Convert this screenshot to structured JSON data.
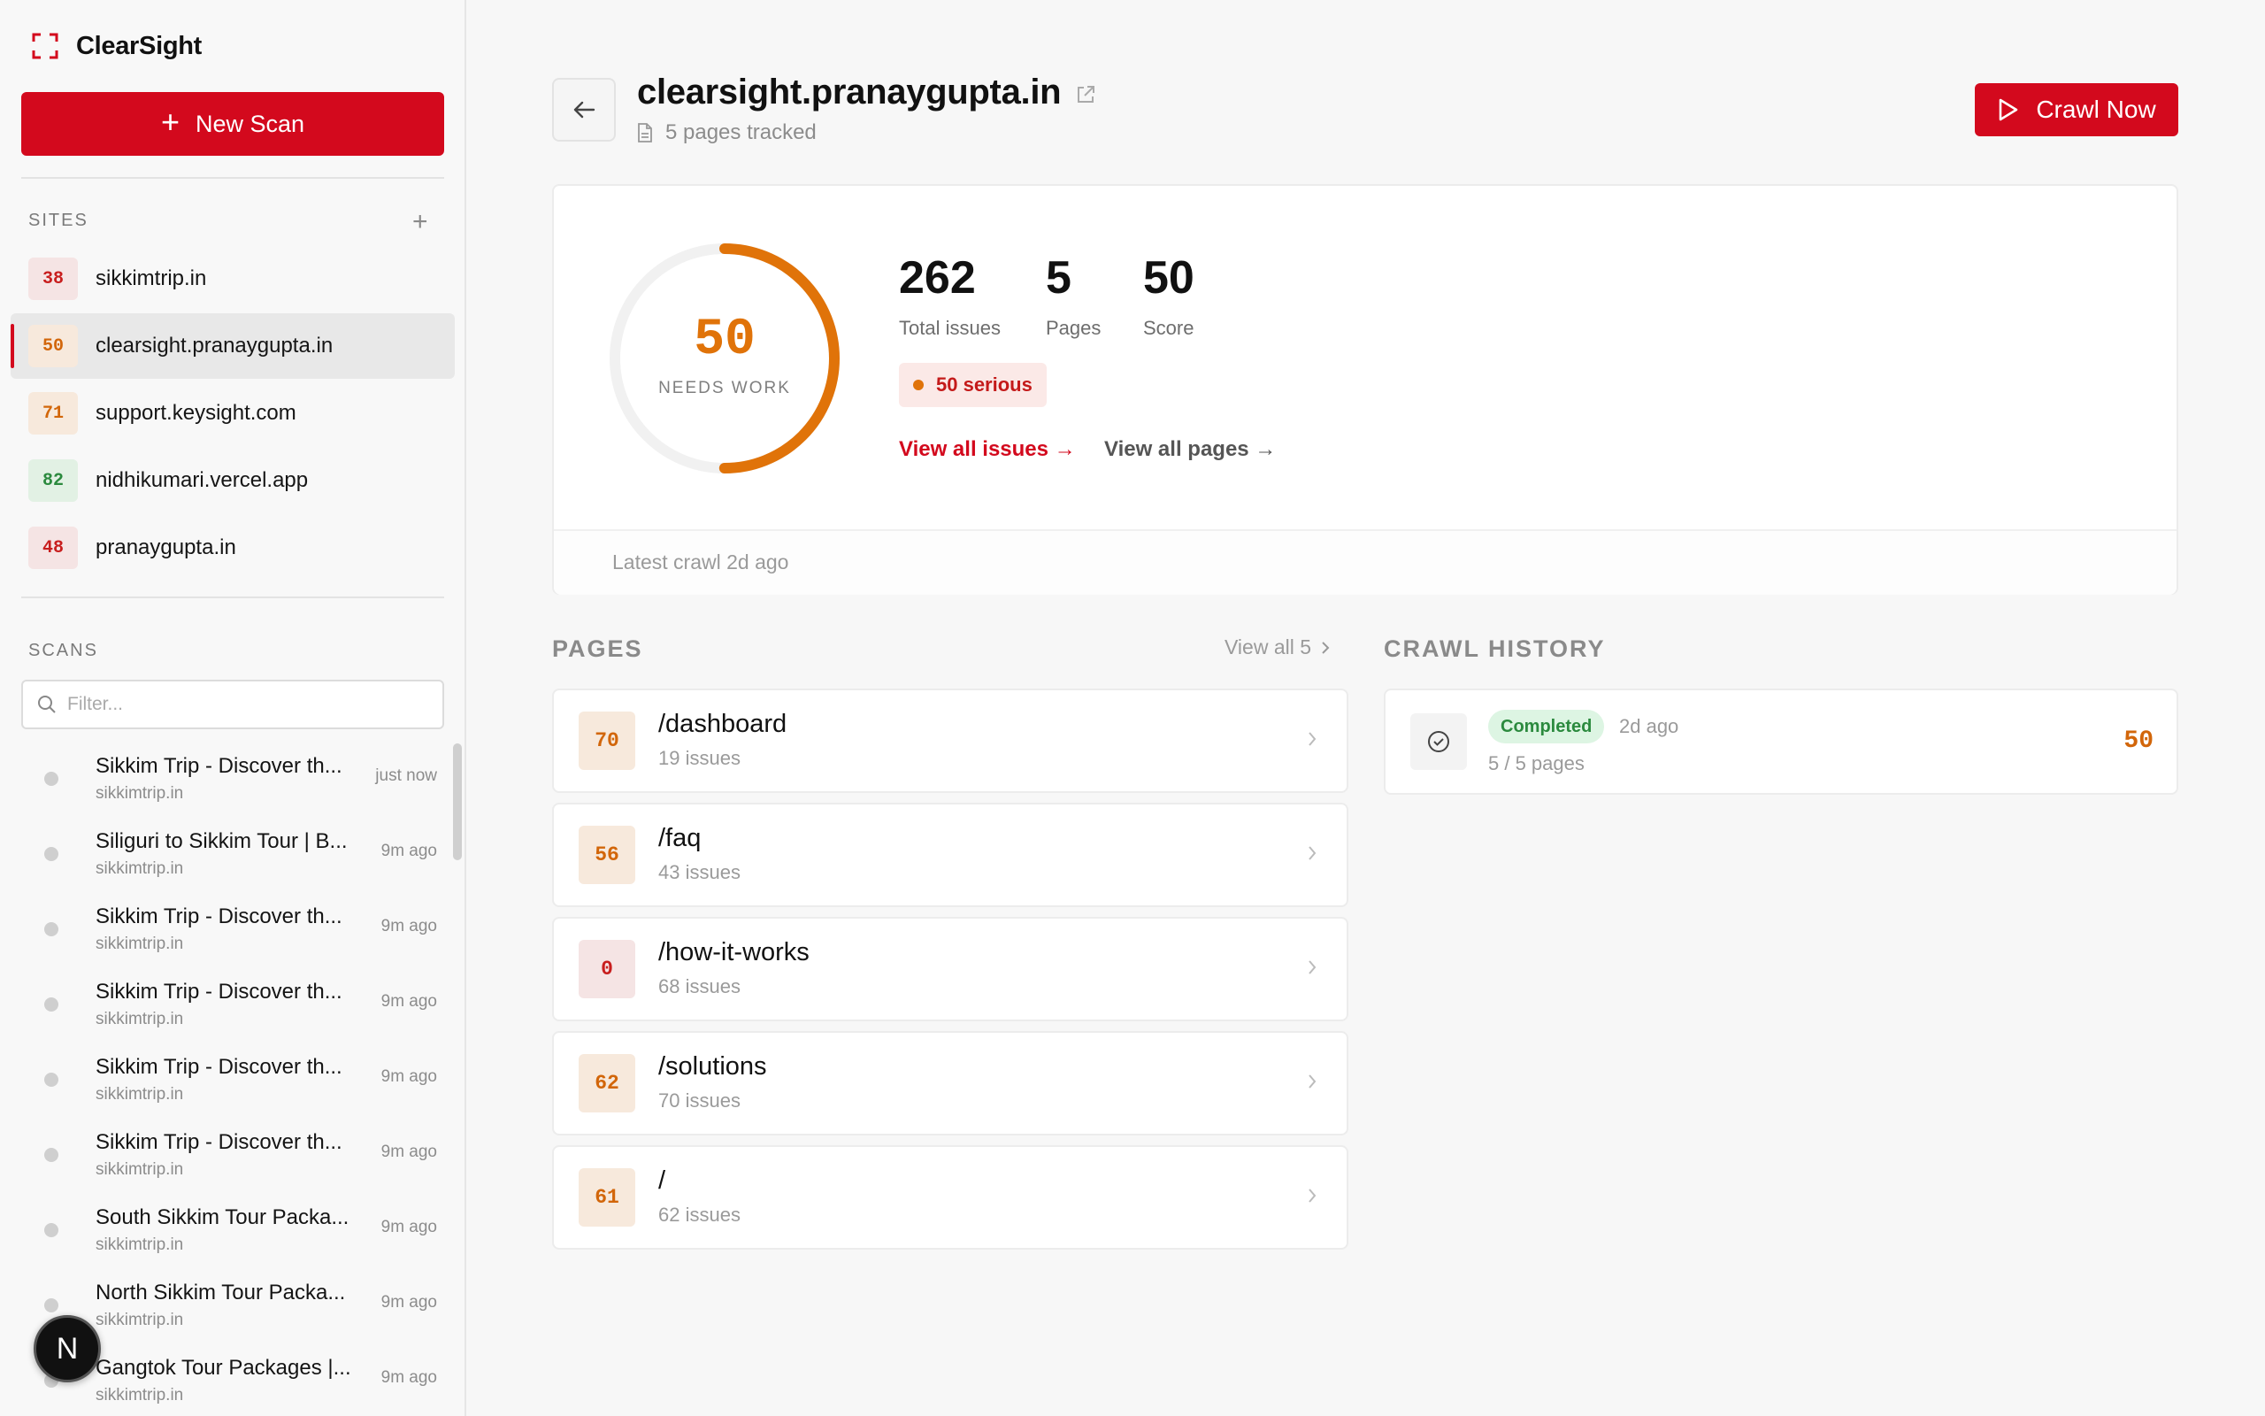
{
  "app": {
    "name": "ClearSight",
    "brand_color": "#d3091d"
  },
  "sidebar": {
    "new_scan_label": "New Scan",
    "sites_heading": "SITES",
    "sites": [
      {
        "score": "38",
        "name": "sikkimtrip.in",
        "tone": "red"
      },
      {
        "score": "50",
        "name": "clearsight.pranaygupta.in",
        "tone": "orange",
        "active": true
      },
      {
        "score": "71",
        "name": "support.keysight.com",
        "tone": "orange"
      },
      {
        "score": "82",
        "name": "nidhikumari.vercel.app",
        "tone": "green"
      },
      {
        "score": "48",
        "name": "pranaygupta.in",
        "tone": "red"
      }
    ],
    "scans_heading": "SCANS",
    "filter_placeholder": "Filter...",
    "scans": [
      {
        "title": "Sikkim Trip - Discover th...",
        "site": "sikkimtrip.in",
        "time": "just now"
      },
      {
        "title": "Siliguri to Sikkim Tour | B...",
        "site": "sikkimtrip.in",
        "time": "9m ago"
      },
      {
        "title": "Sikkim Trip - Discover th...",
        "site": "sikkimtrip.in",
        "time": "9m ago"
      },
      {
        "title": "Sikkim Trip - Discover th...",
        "site": "sikkimtrip.in",
        "time": "9m ago"
      },
      {
        "title": "Sikkim Trip - Discover th...",
        "site": "sikkimtrip.in",
        "time": "9m ago"
      },
      {
        "title": "Sikkim Trip - Discover th...",
        "site": "sikkimtrip.in",
        "time": "9m ago"
      },
      {
        "title": "South Sikkim Tour Packa...",
        "site": "sikkimtrip.in",
        "time": "9m ago"
      },
      {
        "title": "North Sikkim Tour Packa...",
        "site": "sikkimtrip.in",
        "time": "9m ago"
      },
      {
        "title": "Gangtok Tour Packages |...",
        "site": "sikkimtrip.in",
        "time": "9m ago"
      }
    ],
    "dev_badge": "N"
  },
  "header": {
    "site_title": "clearsight.pranaygupta.in",
    "tracked": "5 pages tracked",
    "crawl_label": "Crawl Now"
  },
  "overview": {
    "score": "50",
    "score_fraction": 0.5,
    "score_color": "#e07309",
    "score_label": "NEEDS WORK",
    "stats": [
      {
        "value": "262",
        "label": "Total issues"
      },
      {
        "value": "5",
        "label": "Pages"
      },
      {
        "value": "50",
        "label": "Score"
      }
    ],
    "serious": "50 serious",
    "view_issues": "View all issues →",
    "view_pages": "View all pages →",
    "latest_crawl": "Latest crawl 2d ago"
  },
  "pages": {
    "heading": "PAGES",
    "view_all": "View all 5",
    "items": [
      {
        "score": "70",
        "path": "/dashboard",
        "issues": "19 issues",
        "tone": "orange"
      },
      {
        "score": "56",
        "path": "/faq",
        "issues": "43 issues",
        "tone": "orange"
      },
      {
        "score": "0",
        "path": "/how-it-works",
        "issues": "68 issues",
        "tone": "red"
      },
      {
        "score": "62",
        "path": "/solutions",
        "issues": "70 issues",
        "tone": "orange"
      },
      {
        "score": "61",
        "path": "/",
        "issues": "62 issues",
        "tone": "orange"
      }
    ]
  },
  "history": {
    "heading": "CRAWL HISTORY",
    "items": [
      {
        "status": "Completed",
        "time": "2d ago",
        "pages": "5 / 5 pages",
        "score": "50"
      }
    ]
  }
}
